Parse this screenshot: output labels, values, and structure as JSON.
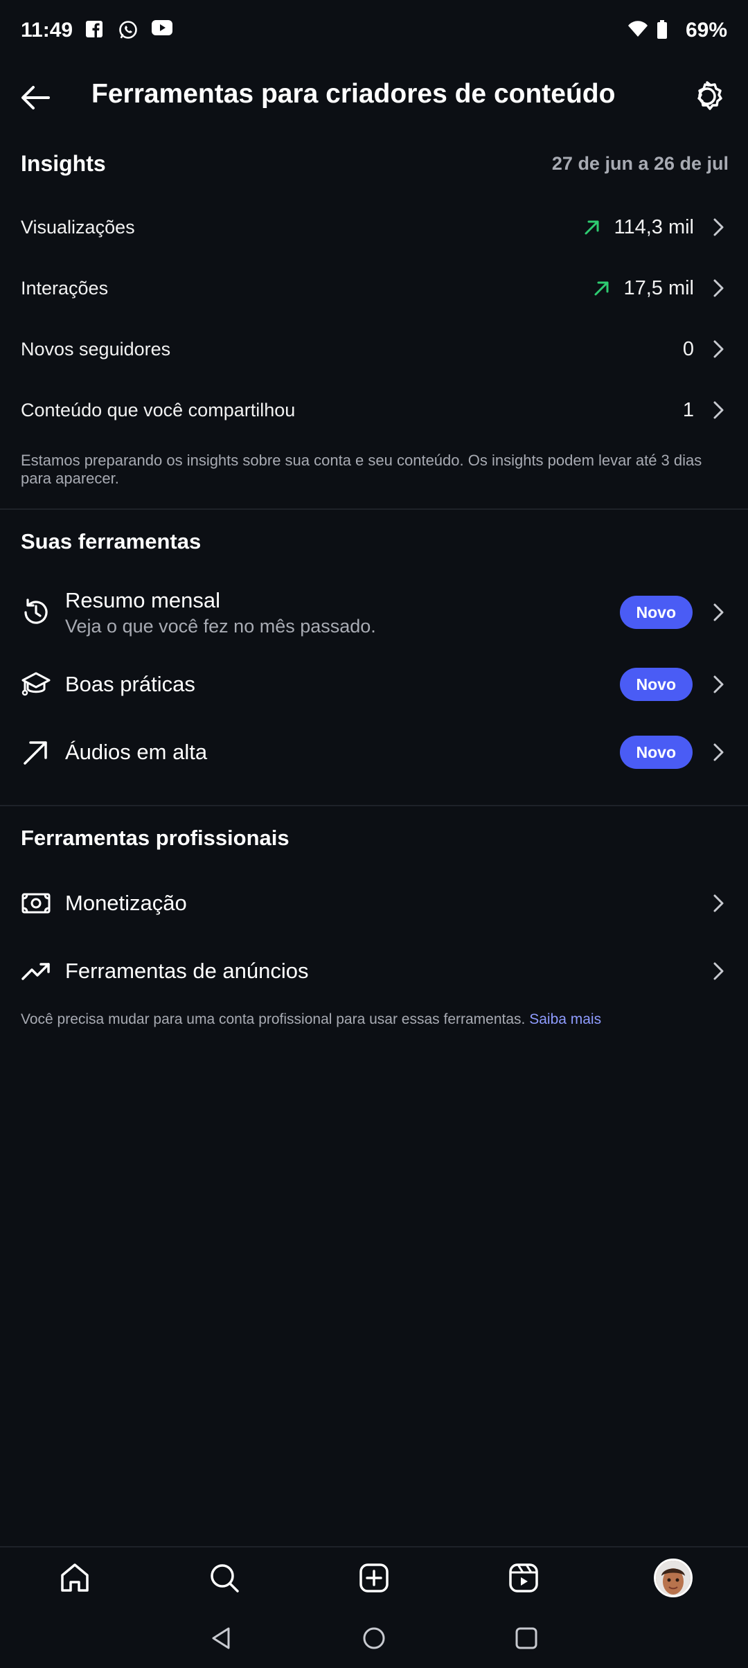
{
  "status_bar": {
    "time": "11:49",
    "battery": "69%",
    "icons": [
      "facebook-icon",
      "whatsapp-icon",
      "youtube-icon",
      "wifi-icon",
      "battery-icon"
    ]
  },
  "header": {
    "title": "Ferramentas para criadores de conteúdo"
  },
  "insights": {
    "title": "Insights",
    "range": "27 de jun a 26 de jul",
    "rows": [
      {
        "label": "Visualizações",
        "value": "114,3 mil",
        "trend": "up"
      },
      {
        "label": "Interações",
        "value": "17,5 mil",
        "trend": "up"
      },
      {
        "label": "Novos seguidores",
        "value": "0"
      },
      {
        "label": "Conteúdo que você compartilhou",
        "value": "1"
      }
    ],
    "note": "Estamos preparando os insights sobre sua conta e seu conteúdo. Os insights podem levar até 3 dias para aparecer."
  },
  "tools": {
    "title": "Suas ferramentas",
    "items": [
      {
        "title": "Resumo mensal",
        "subtitle": "Veja o que você fez no mês passado.",
        "badge": "Novo"
      },
      {
        "title": "Boas práticas",
        "badge": "Novo"
      },
      {
        "title": "Áudios em alta",
        "badge": "Novo"
      }
    ]
  },
  "pro_tools": {
    "title": "Ferramentas profissionais",
    "items": [
      {
        "title": "Monetização"
      },
      {
        "title": "Ferramentas de anúncios"
      }
    ],
    "footnote": "Você precisa mudar para uma conta profissional para usar essas ferramentas.",
    "link": "Saiba mais"
  },
  "colors": {
    "background": "#0c0f14",
    "accent": "#4a5cf5",
    "trend_up": "#2ecc71",
    "link": "#8f9cff",
    "secondary_text": "#a8abb3"
  }
}
